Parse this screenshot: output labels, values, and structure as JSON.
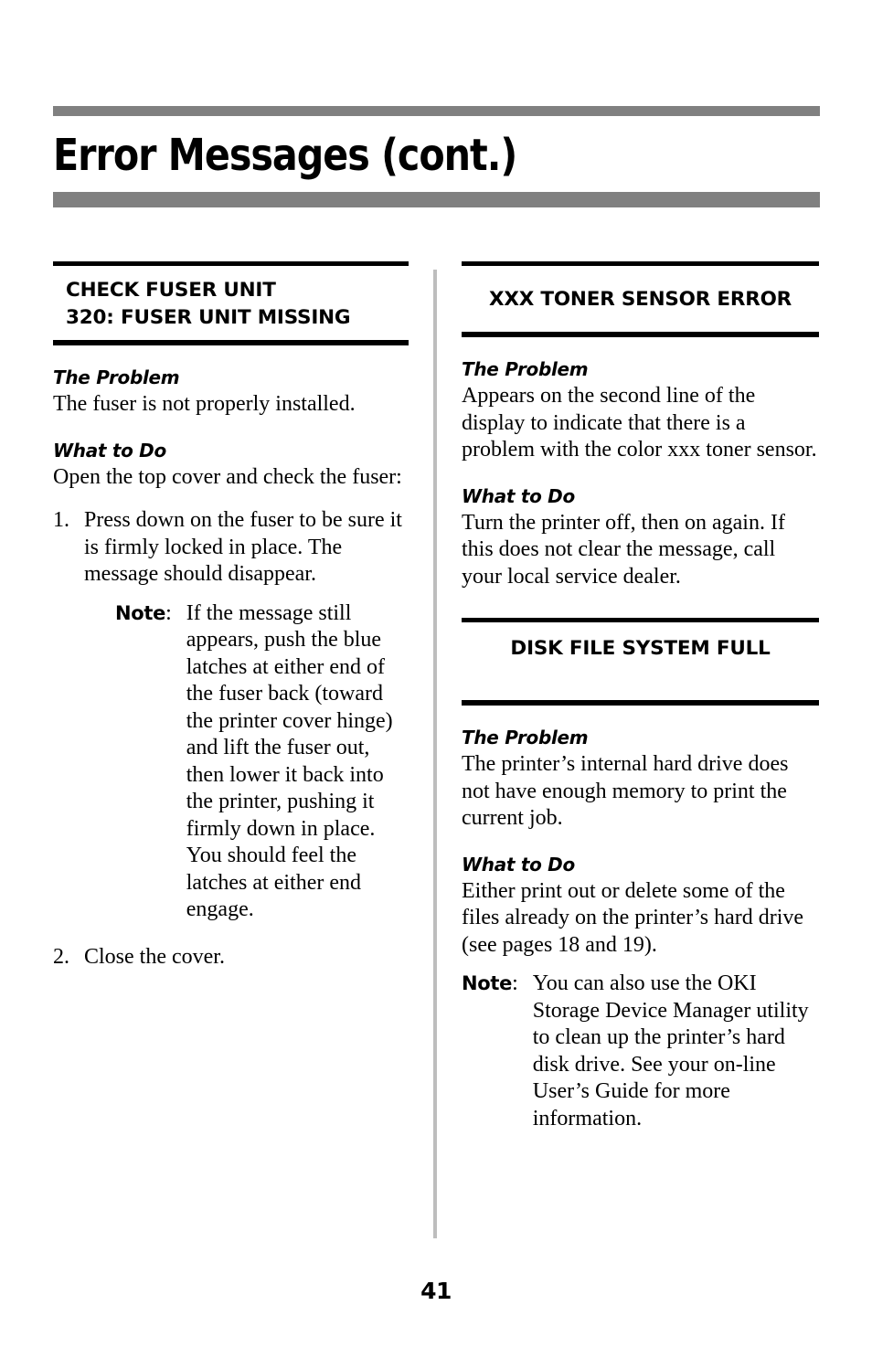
{
  "document": {
    "title": "Error Messages (cont.)",
    "page_number": "41",
    "accent_gray": "#808080",
    "divider_gray": "#bdbdbd",
    "rule_black": "#000000"
  },
  "left_column": {
    "section": {
      "heading_line1": "CHECK FUSER UNIT",
      "heading_line2": "320: FUSER UNIT MISSING",
      "problem_label": "The Problem",
      "problem_text": "The fuser is not properly installed.",
      "whattodo_label": "What to Do",
      "whattodo_text": "Open the top cover and check the fuser:",
      "steps": [
        {
          "num": "1.",
          "text": "Press down on the fuser to be sure it is firmly locked in place. The message should disappear."
        },
        {
          "num": "2.",
          "text": "Close the cover."
        }
      ],
      "note": {
        "label": "Note",
        "colon": ":",
        "text": "If the message still appears, push the blue latches at either end of the fuser back (toward the printer cover hinge) and lift the fuser out, then lower it back into the printer, pushing it firmly down in place. You should feel the latches at either end engage."
      }
    }
  },
  "right_column": {
    "section_toner": {
      "heading": "XXX TONER SENSOR ERROR",
      "problem_label": "The Problem",
      "problem_text": "Appears on the second line of the display to indicate that there is a problem with the color xxx toner sensor.",
      "whattodo_label": "What to Do",
      "whattodo_text": "Turn the printer off, then on again. If this does not clear the message, call your local service dealer."
    },
    "section_disk": {
      "heading": "DISK FILE SYSTEM FULL",
      "problem_label": "The Problem",
      "problem_text": "The printer’s internal hard drive does not have enough memory to print the current job.",
      "whattodo_label": "What to Do",
      "whattodo_text": "Either print out or delete some of the files already on the printer’s hard drive (see pages 18 and 19).",
      "note": {
        "label": "Note",
        "colon": ":",
        "text": "You can also use the OKI Storage Device Manager utility to clean up the printer’s hard disk drive. See your on-line User’s Guide for more information."
      }
    }
  }
}
